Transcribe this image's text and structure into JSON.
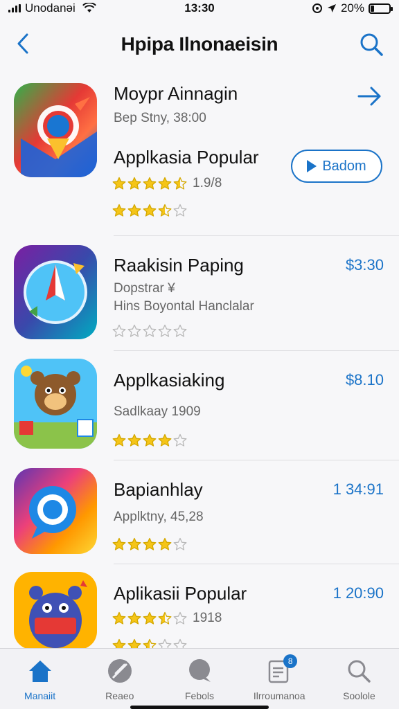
{
  "status_bar": {
    "carrier": "Unodanəi",
    "time": "13:30",
    "battery_percent": "20%",
    "battery_level": 0.2
  },
  "header": {
    "title": "Hpipa Ilnonaeisin",
    "back_icon": "chevron-left-icon",
    "search_icon": "search-icon"
  },
  "featured": {
    "title": "Moypr Ainnagin",
    "subtitle": "Bep Stny, 38:00",
    "section_title": "Applkasia Popular",
    "rating_value": 4.5,
    "rating_text": "1.9/8",
    "secondary_rating": 3.5,
    "button_label": "Badom",
    "accent": "#1a73c8"
  },
  "apps": [
    {
      "title": "Raakisin Paping",
      "subtitle": "Dopstrar ¥",
      "subtitle2": "Hins Boyontal Hanclalar",
      "price": "$3:30",
      "rating": 0
    },
    {
      "title": "Applkasiaking",
      "subtitle": "Sadlkaay 1909",
      "price": "$8.10",
      "rating": 4
    },
    {
      "title": "Bapianhlay",
      "subtitle": "Applktny, 45,28",
      "price": "1 34:91",
      "rating": 4
    },
    {
      "title": "Aplikasii Popular",
      "rating_text": "1918",
      "price": "1 20:90",
      "rating": 3.5,
      "secondary_rating": 2.5
    }
  ],
  "tabs": [
    {
      "label": "Manaiit",
      "icon": "home-icon",
      "active": true
    },
    {
      "label": "Reaeo",
      "icon": "compass-icon",
      "active": false
    },
    {
      "label": "Febols",
      "icon": "chat-bubble-icon",
      "active": false
    },
    {
      "label": "Ilrroumanoa",
      "icon": "clipboard-icon",
      "badge": "8",
      "active": false
    },
    {
      "label": "Soolole",
      "icon": "search-icon",
      "active": false
    }
  ],
  "colors": {
    "accent": "#1a73c8",
    "star_fill": "#f5c518",
    "star_empty": "#b8b8b8"
  }
}
